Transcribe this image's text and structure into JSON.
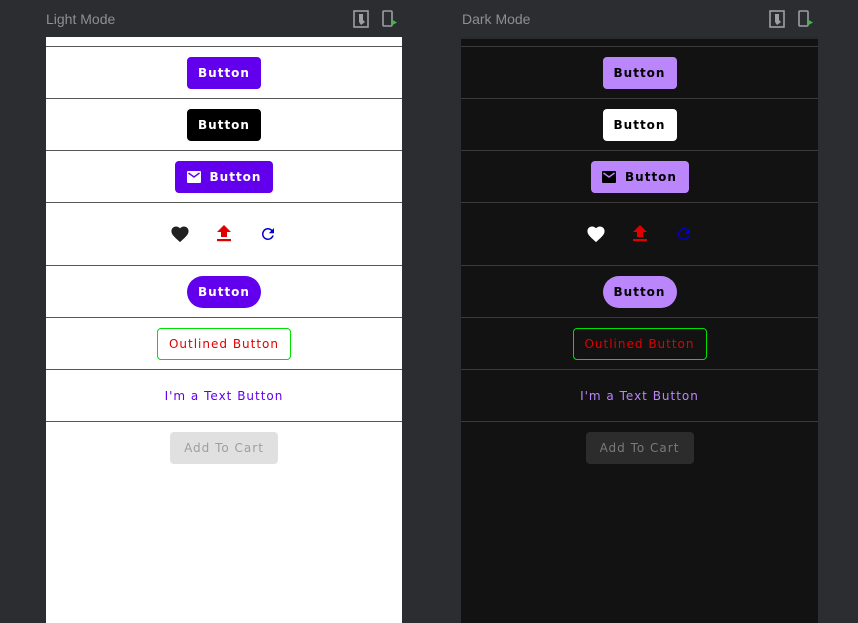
{
  "panels": [
    {
      "title": "Light Mode"
    },
    {
      "title": "Dark Mode"
    }
  ],
  "buttons": {
    "contained": "Button",
    "black": "Button",
    "icon_button": "Button",
    "pill": "Button",
    "outlined": "Outlined Button",
    "text": "I'm a Text Button",
    "disabled": "Add To Cart"
  },
  "icons": [
    "mail-icon",
    "heart-icon",
    "upload-icon",
    "refresh-icon"
  ],
  "colors": {
    "light_primary": "#6200ee",
    "dark_primary": "#bb86fc",
    "outline_border": "#00e000",
    "outline_text": "#e00000",
    "upload_icon": "#e00000",
    "refresh_icon": "#0000cc"
  }
}
